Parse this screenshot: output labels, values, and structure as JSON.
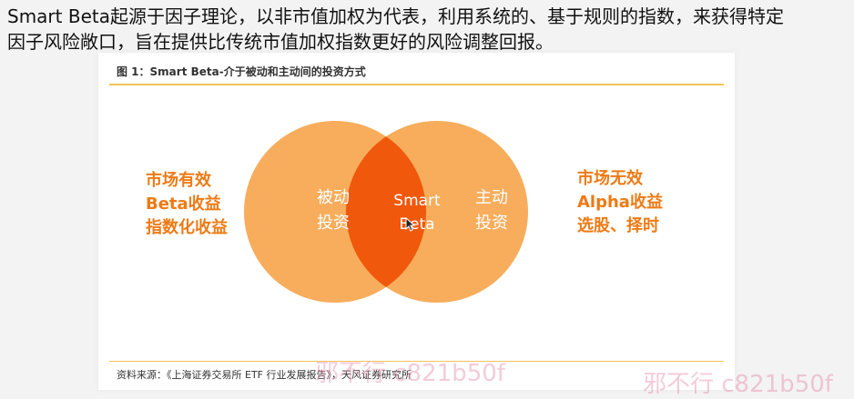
{
  "intro": {
    "line1": "Smart Beta起源于因子理论，以非市值加权为代表，利用系统的、基于规则的指数，来获得特定",
    "line2": "因子风险敞口，旨在提供比传统市值加权指数更好的风险调整回报。"
  },
  "figure": {
    "title": "图 1：Smart Beta-介于被动和主动间的投资方式",
    "left_list": [
      "市场有效",
      "Beta收益",
      "指数化收益"
    ],
    "right_list": [
      "市场无效",
      "Alpha收益",
      "选股、择时"
    ],
    "left_circle": [
      "被动",
      "投资"
    ],
    "right_circle": [
      "主动",
      "投资"
    ],
    "center": [
      "Smart",
      "Beta"
    ],
    "source": "资料来源：《上海证券交易所 ETF 行业发展报告》，天风证券研究所",
    "colors": {
      "circle": "#f7ad5c",
      "overlap": "#f0580c",
      "accent_text": "#ee7a14",
      "rule": "#f2c45a"
    }
  },
  "watermarks": [
    "邪不行 c821b50f",
    "邪不行 c821b50f"
  ]
}
